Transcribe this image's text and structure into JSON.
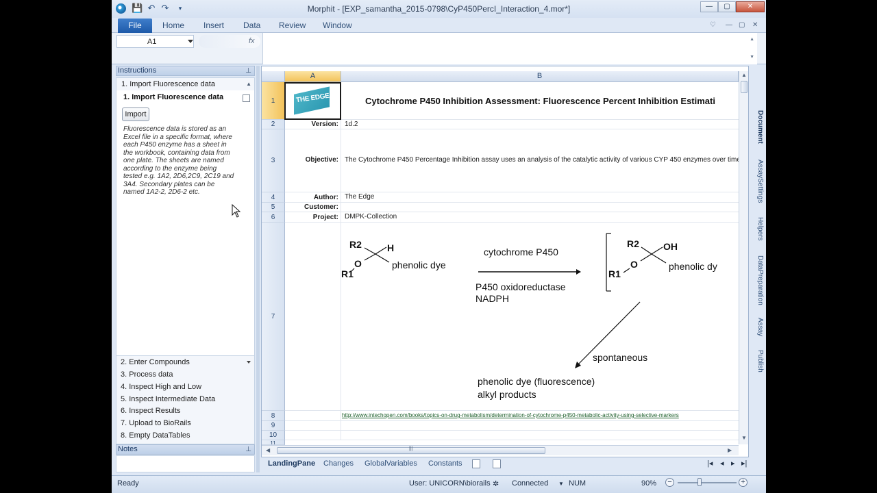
{
  "window": {
    "title": "Morphit - [EXP_samantha_2015-0798\\CyP450PercI_Interaction_4.mor*]",
    "controls": {
      "minimize": "—",
      "maximize": "▢",
      "close": "✕"
    }
  },
  "quick_access": {
    "save": "💾",
    "undo": "↶",
    "redo": "↷",
    "customize": "▾"
  },
  "ribbon": {
    "tabs": [
      {
        "label": "File"
      },
      {
        "label": "Home"
      },
      {
        "label": "Insert"
      },
      {
        "label": "Data"
      },
      {
        "label": "Review"
      },
      {
        "label": "Window"
      }
    ],
    "right_controls": [
      "♡",
      "—",
      "▢",
      "✕"
    ]
  },
  "formula_bar": {
    "cell_ref": "A1",
    "fx": "fx",
    "value": ""
  },
  "instructions": {
    "header": "Instructions",
    "pin": "⊥",
    "current_step_header": "1. Import Fluorescence data",
    "current_step_title": "1. Import Fluorescence data",
    "import_button": "Import",
    "description": "Fluorescence data is stored as an Excel file in a specific format, where each P450 enzyme has a sheet in the workbook, containing data from one plate. The sheets are named according to the enzyme being tested e.g. 1A2, 2D6,2C9, 2C19 and 3A4. Secondary plates can be named 1A2-2, 2D6-2 etc.",
    "steps": [
      "2. Enter Compounds",
      "3. Process data",
      "4. Inspect High and Low",
      "5. Inspect Intermediate Data",
      "6. Inspect Results",
      "7. Upload to BioRails",
      "8. Empty DataTables"
    ]
  },
  "notes": {
    "header": "Notes",
    "pin": "⊥"
  },
  "grid": {
    "columns": [
      "A",
      "B"
    ],
    "row_numbers": [
      "1",
      "2",
      "3",
      "4",
      "5",
      "6",
      "7",
      "8",
      "9",
      "10",
      "11"
    ],
    "title": "Cytochrome P450 Inhibition Assessment: Fluorescence Percent Inhibition Estimati",
    "logo_text": "THE EDGE",
    "rows": [
      {
        "label": "Version:",
        "value": "1d.2"
      },
      {
        "label": "Objective:",
        "value": "The Cytochrome P450 Percentage Inhibition assay uses an analysis of the catalytic activity of various CYP 450 enzymes over time i"
      },
      {
        "label": "Author:",
        "value": "The Edge"
      },
      {
        "label": "Customer:",
        "value": ""
      },
      {
        "label": "Project:",
        "value": "DMPK-Collection"
      }
    ],
    "link": "http://www.intechopen.com/books/topics-on-drug-metabolism/determination-of-cytochrome-p450-metabolic-activity-using-selective-markers"
  },
  "diagram": {
    "r2_left": "R2",
    "h": "H",
    "o_left": "O",
    "r1_left": "R1",
    "dye_left": "phenolic dye",
    "enzyme": "cytochrome P450",
    "cofactor1": "P450 oxidoreductase",
    "cofactor2": "NADPH",
    "r2_right": "R2",
    "oh": "OH",
    "o_right": "O",
    "r1_right": "R1",
    "dye_right": "phenolic dy",
    "spontaneous": "spontaneous",
    "product1": "phenolic dye (fluorescence)",
    "product2": "alkyl products"
  },
  "sheet_tabs": [
    "LandingPane",
    "Changes",
    "GlobalVariables",
    "Constants"
  ],
  "sheet_nav": [
    "|◂",
    "◂",
    "▸",
    "▸|"
  ],
  "right_tabs": [
    "Document",
    "AssaySettings",
    "Helpers",
    "DataPreparation",
    "Assay",
    "Publish"
  ],
  "status": {
    "ready": "Ready",
    "user": "User: UNICORN\\biorails",
    "connection": "Connected",
    "num": "NUM",
    "zoom": "90%"
  }
}
